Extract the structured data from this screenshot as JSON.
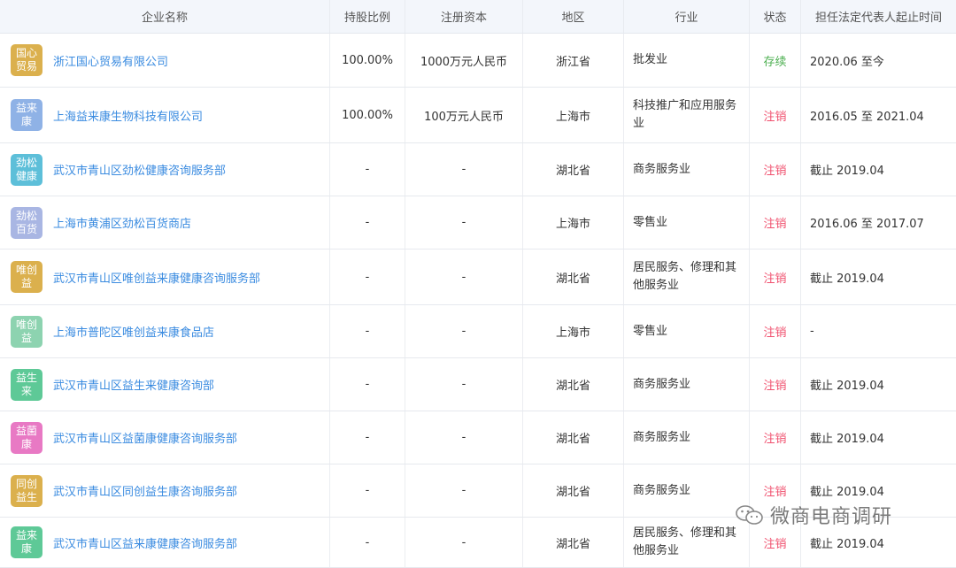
{
  "header": {
    "name": "企业名称",
    "share": "持股比例",
    "capital": "注册资本",
    "region": "地区",
    "industry": "行业",
    "status": "状态",
    "period": "担任法定代表人起止时间"
  },
  "rows": [
    {
      "logo": "国心贸易",
      "logo_color": "#dbb04d",
      "name": "浙江国心贸易有限公司",
      "share": "100.00%",
      "capital": "1000万元人民币",
      "region": "浙江省",
      "industry": "批发业",
      "status": "存续",
      "status_color": "#4caf50",
      "period": "2020.06 至今",
      "height": 60
    },
    {
      "logo": "益来康",
      "logo_color": "#8fb2e6",
      "name": "上海益来康生物科技有限公司",
      "share": "100.00%",
      "capital": "100万元人民币",
      "region": "上海市",
      "industry": "科技推广和应用服务业",
      "status": "注销",
      "status_color": "#f0506e",
      "period": "2016.05 至 2021.04",
      "height": 62
    },
    {
      "logo": "劲松健康",
      "logo_color": "#5dbfd9",
      "name": "武汉市青山区劲松健康咨询服务部",
      "share": "-",
      "capital": "-",
      "region": "湖北省",
      "industry": "商务服务业",
      "status": "注销",
      "status_color": "#f0506e",
      "period": "截止 2019.04",
      "height": 59
    },
    {
      "logo": "劲松百货",
      "logo_color": "#a9b6e3",
      "name": "上海市黄浦区劲松百货商店",
      "share": "-",
      "capital": "-",
      "region": "上海市",
      "industry": "零售业",
      "status": "注销",
      "status_color": "#f0506e",
      "period": "2016.06 至 2017.07",
      "height": 59
    },
    {
      "logo": "唯创益",
      "logo_color": "#dbb04d",
      "name": "武汉市青山区唯创益来康健康咨询服务部",
      "share": "-",
      "capital": "-",
      "region": "湖北省",
      "industry": "居民服务、修理和其他服务业",
      "status": "注销",
      "status_color": "#f0506e",
      "period": "截止 2019.04",
      "height": 62
    },
    {
      "logo": "唯创益",
      "logo_color": "#8dd3b0",
      "name": "上海市普陀区唯创益来康食品店",
      "share": "-",
      "capital": "-",
      "region": "上海市",
      "industry": "零售业",
      "status": "注销",
      "status_color": "#f0506e",
      "period": "-",
      "height": 59
    },
    {
      "logo": "益生来",
      "logo_color": "#5ec997",
      "name": "武汉市青山区益生来健康咨询部",
      "share": "-",
      "capital": "-",
      "region": "湖北省",
      "industry": "商务服务业",
      "status": "注销",
      "status_color": "#f0506e",
      "period": "截止 2019.04",
      "height": 59
    },
    {
      "logo": "益菌康",
      "logo_color": "#e879c4",
      "name": "武汉市青山区益菌康健康咨询服务部",
      "share": "-",
      "capital": "-",
      "region": "湖北省",
      "industry": "商务服务业",
      "status": "注销",
      "status_color": "#f0506e",
      "period": "截止 2019.04",
      "height": 59
    },
    {
      "logo": "同创益生",
      "logo_color": "#dbb04d",
      "name": "武汉市青山区同创益生康咨询服务部",
      "share": "-",
      "capital": "-",
      "region": "湖北省",
      "industry": "商务服务业",
      "status": "注销",
      "status_color": "#f0506e",
      "period": "截止 2019.04",
      "height": 59
    },
    {
      "logo": "益来康",
      "logo_color": "#5ec997",
      "name": "武汉市青山区益来康健康咨询服务部",
      "share": "-",
      "capital": "-",
      "region": "湖北省",
      "industry": "居民服务、修理和其他服务业",
      "status": "注销",
      "status_color": "#f0506e",
      "period": "截止 2019.04",
      "height": 56
    }
  ],
  "watermark": {
    "text": "微商电商调研",
    "icon": "wechat-icon"
  }
}
